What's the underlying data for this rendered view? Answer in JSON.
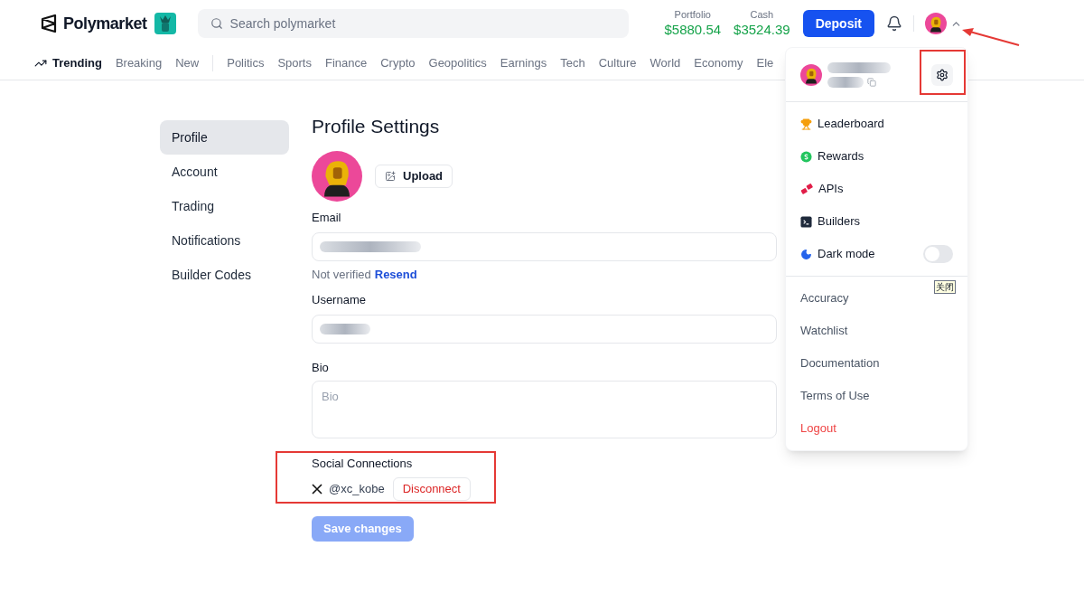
{
  "header": {
    "logo": "Polymarket",
    "search": {
      "placeholder": "Search polymarket"
    },
    "balances": [
      {
        "label": "Portfolio",
        "value": "$5880.54"
      },
      {
        "label": "Cash",
        "value": "$3524.39"
      }
    ],
    "deposit": "Deposit",
    "menu_open": true
  },
  "nav": {
    "primary": [
      {
        "label": "Trending",
        "selected": true
      },
      {
        "label": "Breaking",
        "selected": false
      },
      {
        "label": "New",
        "selected": false
      }
    ],
    "categories": [
      "Politics",
      "Sports",
      "Finance",
      "Crypto",
      "Geopolitics",
      "Earnings",
      "Tech",
      "Culture",
      "World",
      "Economy",
      "Ele"
    ]
  },
  "sidebar": {
    "items": [
      {
        "label": "Profile",
        "selected": true
      },
      {
        "label": "Account",
        "selected": false
      },
      {
        "label": "Trading",
        "selected": false
      },
      {
        "label": "Notifications",
        "selected": false
      },
      {
        "label": "Builder Codes",
        "selected": false
      }
    ]
  },
  "profile": {
    "title": "Profile Settings",
    "upload": "Upload",
    "email": {
      "label": "Email",
      "status": "Not verified",
      "action": "Resend"
    },
    "username": {
      "label": "Username"
    },
    "bio": {
      "label": "Bio",
      "placeholder": "Bio"
    },
    "social": {
      "title": "Social Connections",
      "handle": "@xc_kobe",
      "action": "Disconnect"
    },
    "save": {
      "label": "Save changes",
      "disabled": true
    }
  },
  "menu": {
    "items": [
      {
        "label": "Leaderboard",
        "kind": "trophy"
      },
      {
        "label": "Rewards",
        "kind": "dollar"
      },
      {
        "label": "APIs",
        "kind": "api"
      },
      {
        "label": "Builders",
        "kind": "terminal"
      }
    ],
    "dark_mode": {
      "label": "Dark mode",
      "on": false
    },
    "tooltip": "关闭",
    "links": [
      {
        "label": "Accuracy",
        "kind": "link"
      },
      {
        "label": "Watchlist",
        "kind": "link"
      },
      {
        "label": "Documentation",
        "kind": "link"
      },
      {
        "label": "Terms of Use",
        "kind": "link"
      },
      {
        "label": "Logout",
        "kind": "danger"
      }
    ]
  }
}
